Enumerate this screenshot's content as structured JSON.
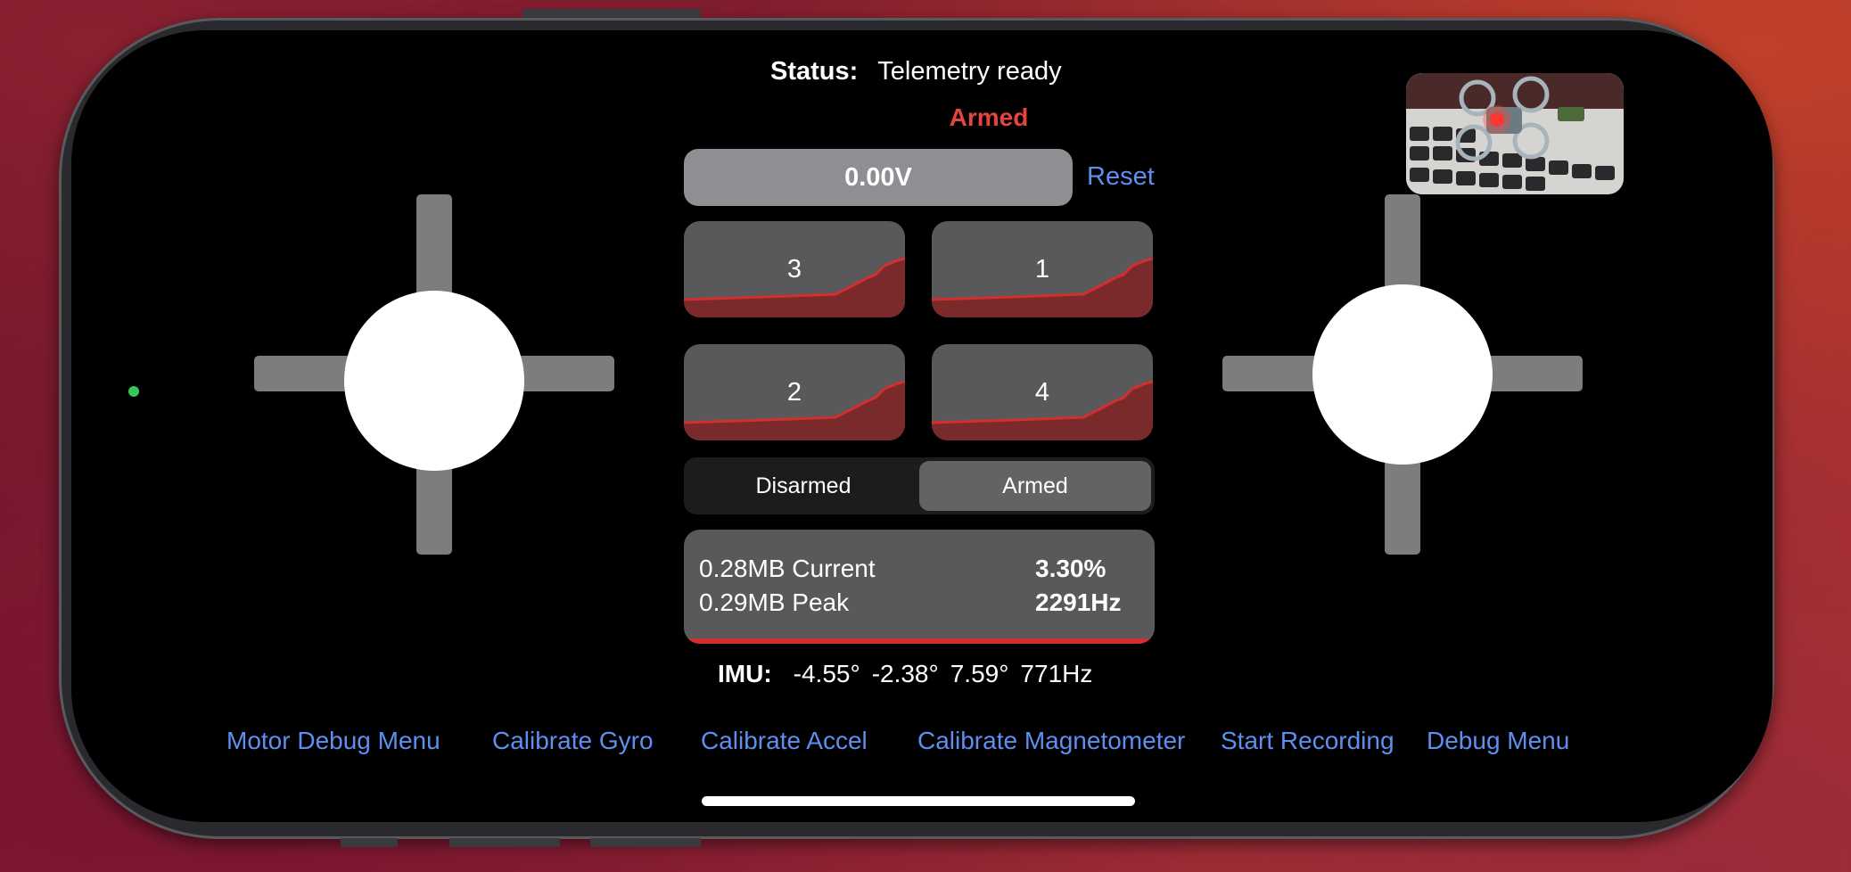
{
  "status": {
    "label": "Status:",
    "value": "Telemetry ready",
    "armed_indicator": "Armed",
    "armed_color": "#e6453f"
  },
  "battery": {
    "voltage": "0.00V",
    "reset_label": "Reset"
  },
  "motors": [
    {
      "id": "3"
    },
    {
      "id": "1"
    },
    {
      "id": "2"
    },
    {
      "id": "4"
    }
  ],
  "arm_toggle": {
    "options": [
      "Disarmed",
      "Armed"
    ],
    "selected": "Armed"
  },
  "performance": {
    "memory_current": "0.28MB Current",
    "memory_peak": "0.29MB Peak",
    "cpu": "3.30%",
    "frequency": "2291Hz"
  },
  "imu": {
    "label": "IMU:",
    "roll": "-4.55°",
    "pitch": "-2.38°",
    "yaw": "7.59°",
    "rate": "771Hz"
  },
  "actions": [
    "Motor Debug Menu",
    "Calibrate Gyro",
    "Calibrate Accel",
    "Calibrate Magnetometer",
    "Start Recording",
    "Debug Menu"
  ],
  "colors": {
    "link": "#5e8ff0",
    "connection_dot": "#34c759",
    "trace": "#d32f2f"
  }
}
